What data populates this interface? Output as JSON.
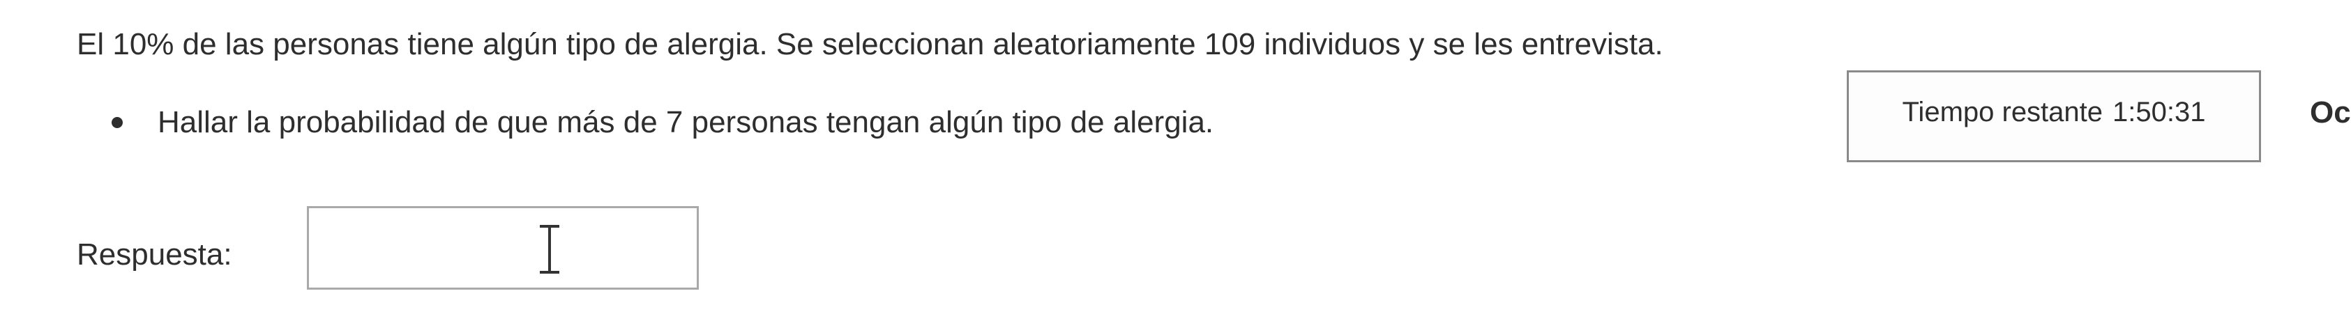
{
  "question": {
    "text": "El 10% de las personas tiene algún tipo de alergia. Se seleccionan aleatoriamente 109 individuos y se les entrevista."
  },
  "task": {
    "text": "Hallar la probabilidad de que más de 7 personas tengan algún tipo de alergia."
  },
  "timer": {
    "label": "Tiempo restante",
    "value": "1:50:31"
  },
  "hide_button": {
    "label": "Ocultar"
  },
  "answer": {
    "label": "Respuesta:",
    "value": ""
  },
  "icons": {
    "cursor": "text-cursor-icon"
  }
}
